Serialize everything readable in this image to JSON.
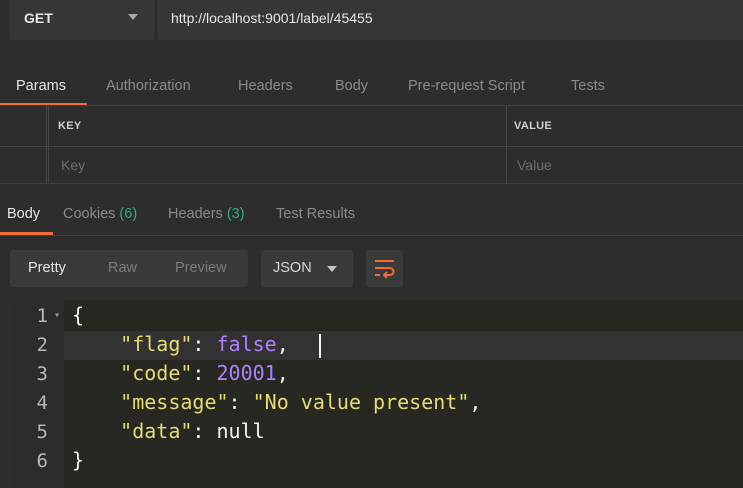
{
  "request": {
    "method": "GET",
    "url": "http://localhost:9001/label/45455",
    "tabs": [
      "Params",
      "Authorization",
      "Headers",
      "Body",
      "Pre-request Script",
      "Tests"
    ],
    "active_tab": "Params"
  },
  "params_table": {
    "key_header": "KEY",
    "value_header": "VALUE",
    "key_placeholder": "Key",
    "value_placeholder": "Value"
  },
  "response": {
    "tabs": {
      "body": "Body",
      "cookies": "Cookies",
      "cookies_count": "(6)",
      "headers": "Headers",
      "headers_count": "(3)",
      "test_results": "Test Results"
    },
    "view_modes": [
      "Pretty",
      "Raw",
      "Preview"
    ],
    "active_view": "Pretty",
    "format": "JSON",
    "icons": {
      "method_dropdown": "chevron-down-icon",
      "format_dropdown": "chevron-down-icon",
      "wrap": "wrap-lines-icon",
      "fold": "fold-arrow-icon"
    },
    "accent_color": "#ef6c35",
    "count_color": "#36a88a",
    "line_numbers": [
      "1",
      "2",
      "3",
      "4",
      "5",
      "6"
    ],
    "lines": {
      "l1": "{",
      "l2_key": "\"flag\"",
      "l2_sep": ": ",
      "l2_val": "false",
      "l2_end": ",",
      "l3_key": "\"code\"",
      "l3_sep": ": ",
      "l3_val": "20001",
      "l3_end": ",",
      "l4_key": "\"message\"",
      "l4_sep": ": ",
      "l4_val": "\"No value present\"",
      "l4_end": ",",
      "l5_key": "\"data\"",
      "l5_sep": ": ",
      "l5_val": "null",
      "l6": "}"
    }
  }
}
